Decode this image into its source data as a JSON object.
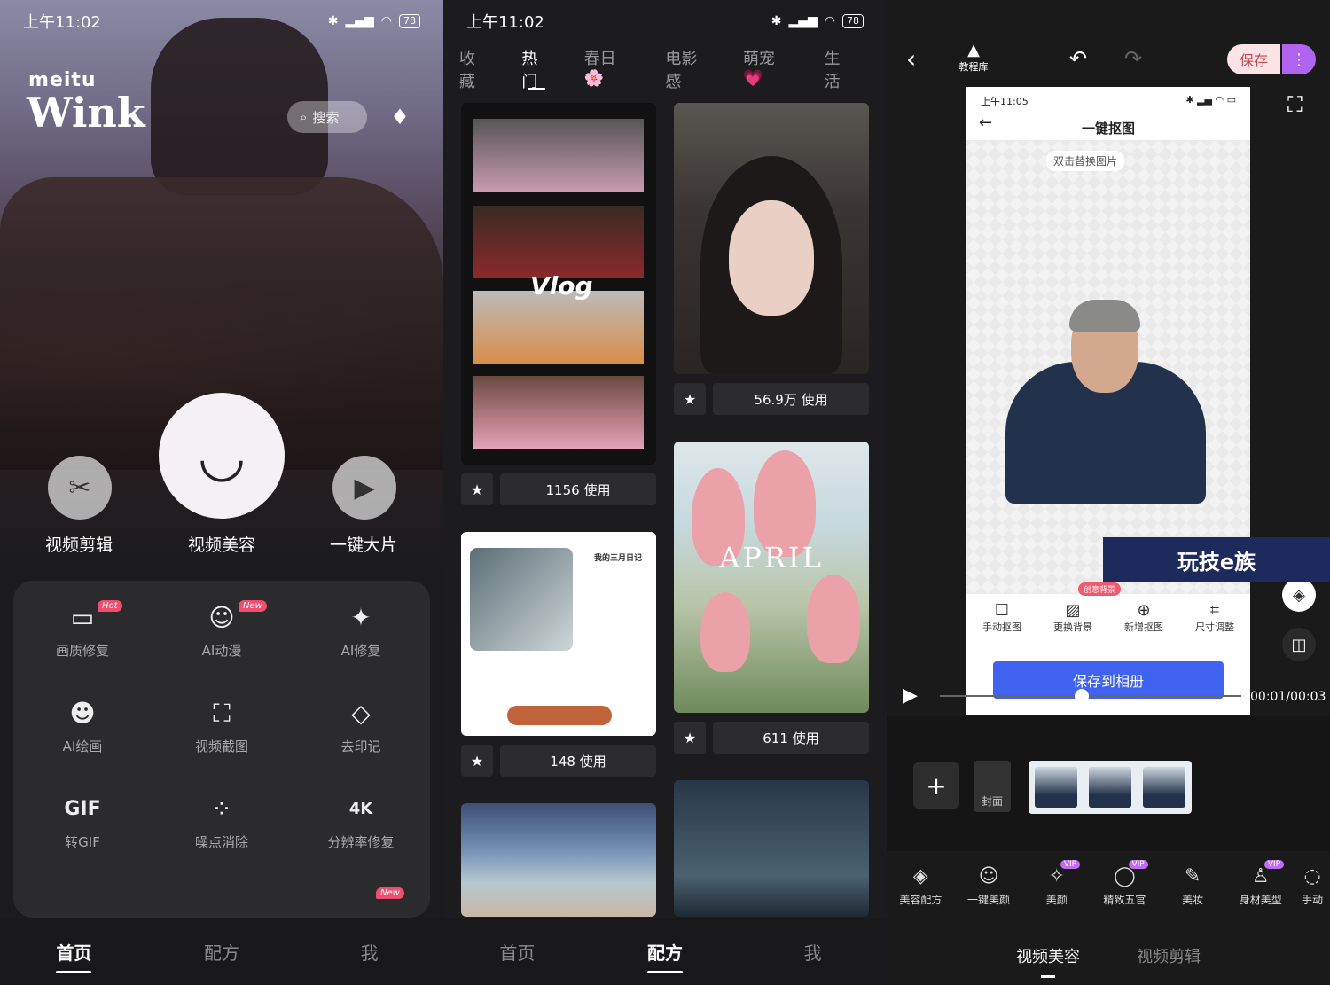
{
  "status": {
    "time": "上午11:02",
    "battery": "78"
  },
  "home": {
    "logo_small": "meitu",
    "logo_big": "Wink",
    "search_placeholder": "搜索",
    "main_buttons": [
      {
        "label": "视频剪辑",
        "icon": "scissors-icon"
      },
      {
        "label": "视频美容",
        "icon": "wink-face-icon"
      },
      {
        "label": "一键大片",
        "icon": "play-icon"
      }
    ],
    "tools": [
      {
        "label": "画质修复",
        "icon": "hd-icon",
        "badge": "Hot"
      },
      {
        "label": "AI动漫",
        "icon": "planet-face-icon",
        "badge": "New"
      },
      {
        "label": "AI修复",
        "icon": "ai-icon",
        "badge": ""
      },
      {
        "label": "AI绘画",
        "icon": "robot-icon",
        "badge": ""
      },
      {
        "label": "视频截图",
        "icon": "screenshot-icon",
        "badge": ""
      },
      {
        "label": "去印记",
        "icon": "eraser-icon",
        "badge": ""
      },
      {
        "label": "转GIF",
        "icon": "gif-icon",
        "badge": ""
      },
      {
        "label": "噪点消除",
        "icon": "noise-icon",
        "badge": ""
      },
      {
        "label": "分辨率修复",
        "icon": "4k-icon",
        "badge": "New"
      }
    ],
    "nav": [
      "首页",
      "配方",
      "我"
    ]
  },
  "recipes": {
    "categories": [
      "收藏",
      "热门",
      "春日🌸",
      "电影感",
      "萌宠💗",
      "生活"
    ],
    "active_category": "热门",
    "cards": [
      {
        "overlay": "Vlog",
        "usage": "1156 使用"
      },
      {
        "overlay": "",
        "usage": "56.9万 使用"
      },
      {
        "overlay": "APRIL",
        "usage": "611 使用"
      },
      {
        "overlay": "我的三月日记",
        "usage": "148 使用"
      }
    ],
    "nav": [
      "首页",
      "配方",
      "我"
    ]
  },
  "editor": {
    "tutorial": "教程库",
    "save": "保存",
    "phone_time": "上午11:05",
    "phone_title": "一键抠图",
    "hint": "双击替换图片",
    "watermark": "玩技e族",
    "creative_tag": "创意背景",
    "phone_tools": [
      "手动抠图",
      "更换背景",
      "新增抠图",
      "尺寸调整"
    ],
    "save_album": "保存到相册",
    "time": "00:01/00:03",
    "progress": 0.33,
    "cover": "封面",
    "beauty_tools": [
      {
        "label": "美容配方",
        "vip": false
      },
      {
        "label": "一键美颜",
        "vip": false
      },
      {
        "label": "美颜",
        "vip": true
      },
      {
        "label": "精致五官",
        "vip": true
      },
      {
        "label": "美妆",
        "vip": false
      },
      {
        "label": "身材美型",
        "vip": true
      },
      {
        "label": "手动",
        "vip": false
      }
    ],
    "tabs": [
      "视频美容",
      "视频剪辑"
    ]
  }
}
